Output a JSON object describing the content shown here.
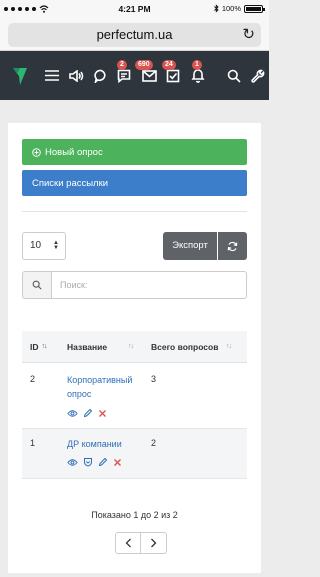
{
  "status_bar": {
    "time": "4:21 PM",
    "battery": "100%"
  },
  "browser": {
    "url": "perfectum.ua"
  },
  "navbar": {
    "badges": {
      "tasks_chat": "2",
      "mail": "690",
      "checklist": "24",
      "notifications": "1"
    }
  },
  "actions": {
    "new_poll": "Новый опрос",
    "mailing_lists": "Списки рассылки",
    "page_size": "10",
    "export": "Экспорт"
  },
  "search": {
    "placeholder": "Поиск:"
  },
  "table": {
    "columns": [
      "ID",
      "Название",
      "Всего вопросов"
    ],
    "rows": [
      {
        "id": "2",
        "name_line1": "Корпоративный",
        "name_line2": "опрос",
        "questions": "3"
      },
      {
        "id": "1",
        "name_line1": "ДР компании",
        "questions": "2"
      }
    ]
  },
  "pagination": {
    "info": "Показано 1 до 2 из 2"
  }
}
